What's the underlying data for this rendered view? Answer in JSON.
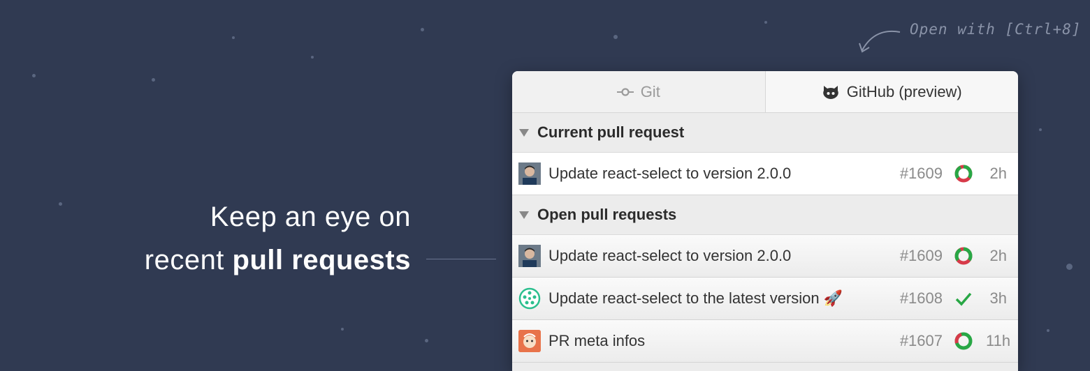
{
  "tagline": {
    "line1": "Keep an eye on",
    "line2_prefix": "recent ",
    "line2_bold": "pull requests"
  },
  "hint": "Open with [Ctrl+8]",
  "tabs": [
    {
      "label": "Git",
      "icon": "git-commit-icon",
      "active": false
    },
    {
      "label": "GitHub (preview)",
      "icon": "octocat-icon",
      "active": true
    }
  ],
  "current_section": {
    "title": "Current pull request",
    "rows": [
      {
        "title": "Update react-select to version 2.0.0",
        "number": "#1609",
        "status": "pending",
        "age": "2h",
        "avatar": "user-photo"
      }
    ]
  },
  "open_section": {
    "title": "Open pull requests",
    "rows": [
      {
        "title": "Update react-select to version 2.0.0",
        "number": "#1609",
        "status": "pending",
        "age": "2h",
        "avatar": "user-photo"
      },
      {
        "title": "Update react-select to the latest version 🚀",
        "number": "#1608",
        "status": "success",
        "age": "3h",
        "avatar": "bot-avatar"
      },
      {
        "title": "PR meta infos",
        "number": "#1607",
        "status": "pending",
        "age": "11h",
        "avatar": "orange-avatar"
      }
    ]
  },
  "colors": {
    "background": "#303a52",
    "success": "#28a745",
    "failure": "#d73a49"
  }
}
